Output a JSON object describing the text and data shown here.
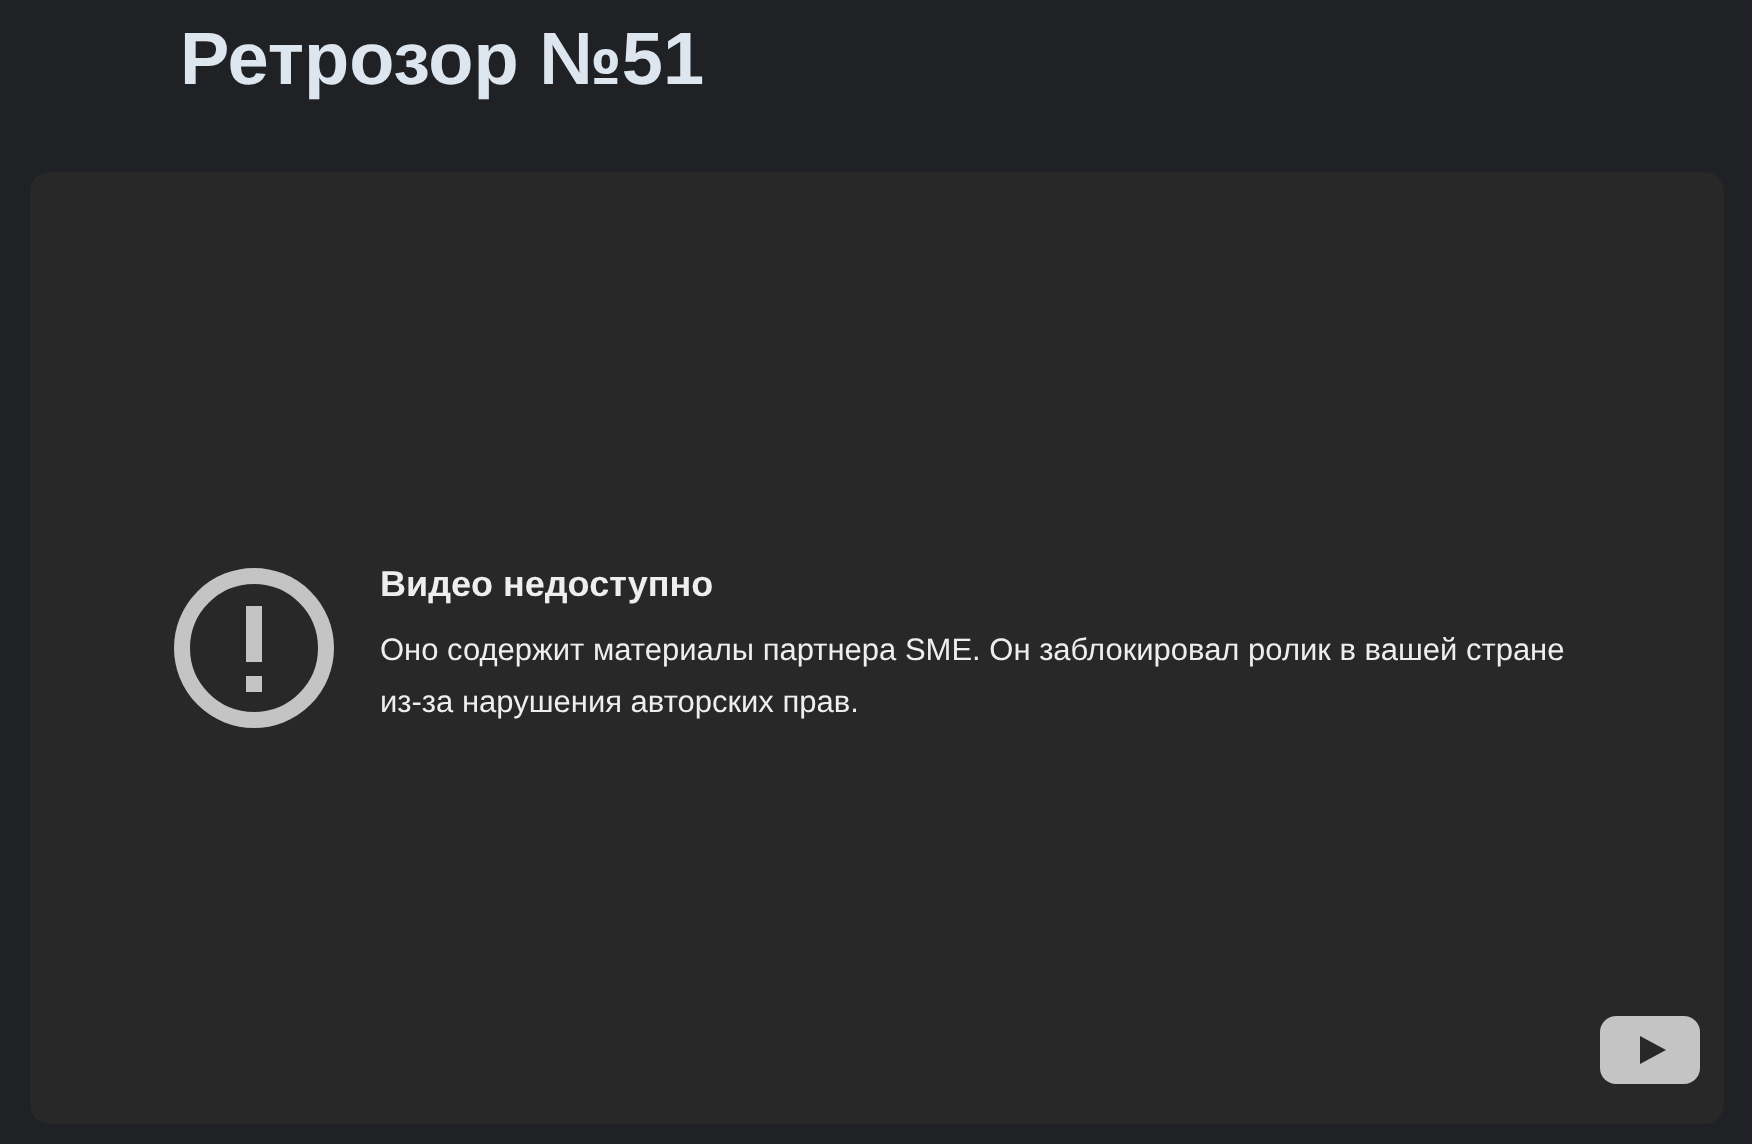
{
  "page": {
    "title": "Ретрозор №51"
  },
  "player": {
    "error_title": "Видео недоступно",
    "error_message": "Оно содержит материалы партнера SME. Он заблокировал ролик в вашей стране из-за нарушения авторских прав."
  }
}
